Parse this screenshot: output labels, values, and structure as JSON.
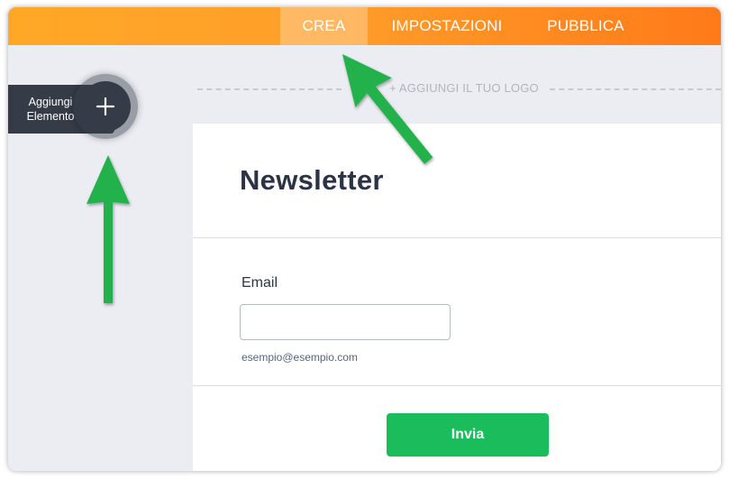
{
  "topbar": {
    "tabs": [
      {
        "label": "CREA",
        "active": true
      },
      {
        "label": "IMPOSTAZIONI",
        "active": false
      },
      {
        "label": "PUBBLICA",
        "active": false
      }
    ],
    "gradient_colors": [
      "#ffa826",
      "#ff7a19"
    ]
  },
  "logo": {
    "add_label": "+ AGGIUNGI IL TUO LOGO"
  },
  "sidebar": {
    "add_element_label": "Aggiungi Elemento",
    "add_icon": "plus-icon"
  },
  "form": {
    "title": "Newsletter",
    "email_label": "Email",
    "email_value": "",
    "email_placeholder": "",
    "email_sublabel": "esempio@esempio.com",
    "submit_label": "Invia",
    "submit_color": "#1bbc5c"
  },
  "annotations": {
    "arrow_color": "#22b14c",
    "arrow_icon": "arrow-up-icon"
  }
}
